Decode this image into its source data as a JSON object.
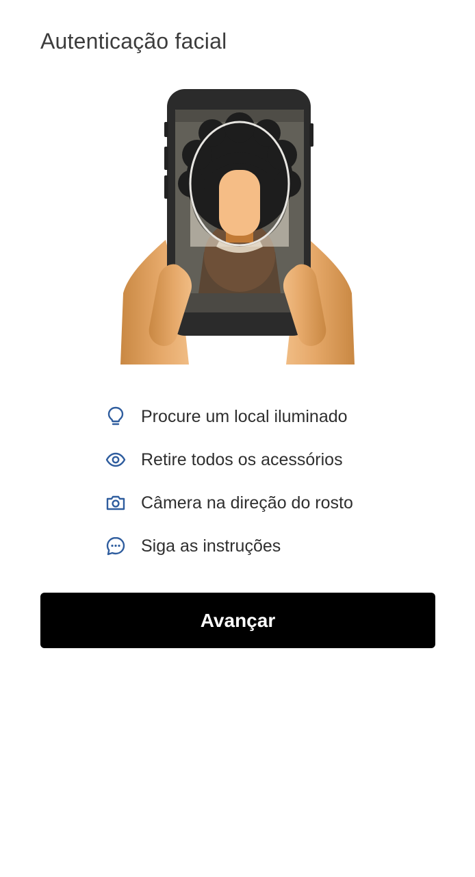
{
  "header": {
    "title": "Autenticação facial"
  },
  "illustration": {
    "name": "face-authentication-illustration"
  },
  "tips": [
    {
      "icon": "lightbulb-icon",
      "label": "Procure um local iluminado"
    },
    {
      "icon": "eye-icon",
      "label": "Retire todos os acessórios"
    },
    {
      "icon": "camera-icon",
      "label": "Câmera na direção do rosto"
    },
    {
      "icon": "chat-bubble-icon",
      "label": "Siga as instruções"
    }
  ],
  "actions": {
    "next_label": "Avançar"
  },
  "colors": {
    "icon": "#2f5d9e",
    "button_background": "#000000",
    "button_text": "#ffffff"
  }
}
